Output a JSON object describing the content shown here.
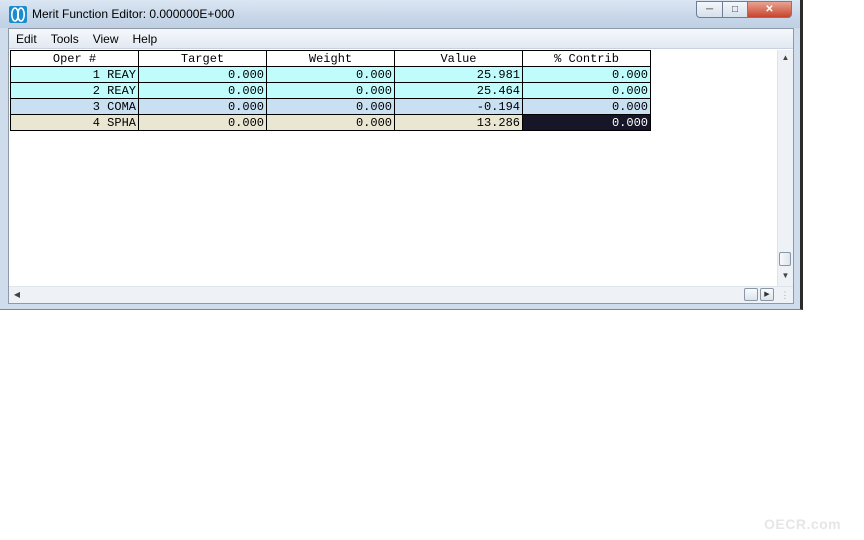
{
  "window": {
    "title": "Merit Function Editor: 0.000000E+000",
    "app_icon": "zemax-lens-icon"
  },
  "caption_buttons": {
    "minimize_icon": "minimize-icon",
    "maximize_icon": "maximize-icon",
    "close_icon": "close-icon"
  },
  "menu": {
    "items": [
      {
        "label": "Edit"
      },
      {
        "label": "Tools"
      },
      {
        "label": "View"
      },
      {
        "label": "Help"
      }
    ]
  },
  "table": {
    "columns": [
      "Oper #",
      "Target",
      "Weight",
      "Value",
      "% Contrib"
    ],
    "rows": [
      {
        "oper": "1 REAY",
        "target": "0.000",
        "weight": "0.000",
        "value": "25.981",
        "contrib": "0.000",
        "row_color": "#c0fcfc"
      },
      {
        "oper": "2 REAY",
        "target": "0.000",
        "weight": "0.000",
        "value": "25.464",
        "contrib": "0.000",
        "row_color": "#c0fcfc"
      },
      {
        "oper": "3 COMA",
        "target": "0.000",
        "weight": "0.000",
        "value": "-0.194",
        "contrib": "0.000",
        "row_color": "#c9dff2"
      },
      {
        "oper": "4 SPHA",
        "target": "0.000",
        "weight": "0.000",
        "value": "13.286",
        "contrib": "0.000",
        "row_color": "#e9e6d2"
      }
    ],
    "selected_cell": {
      "row": 4,
      "column": "% Contrib"
    }
  },
  "watermark": "OECR.com"
}
